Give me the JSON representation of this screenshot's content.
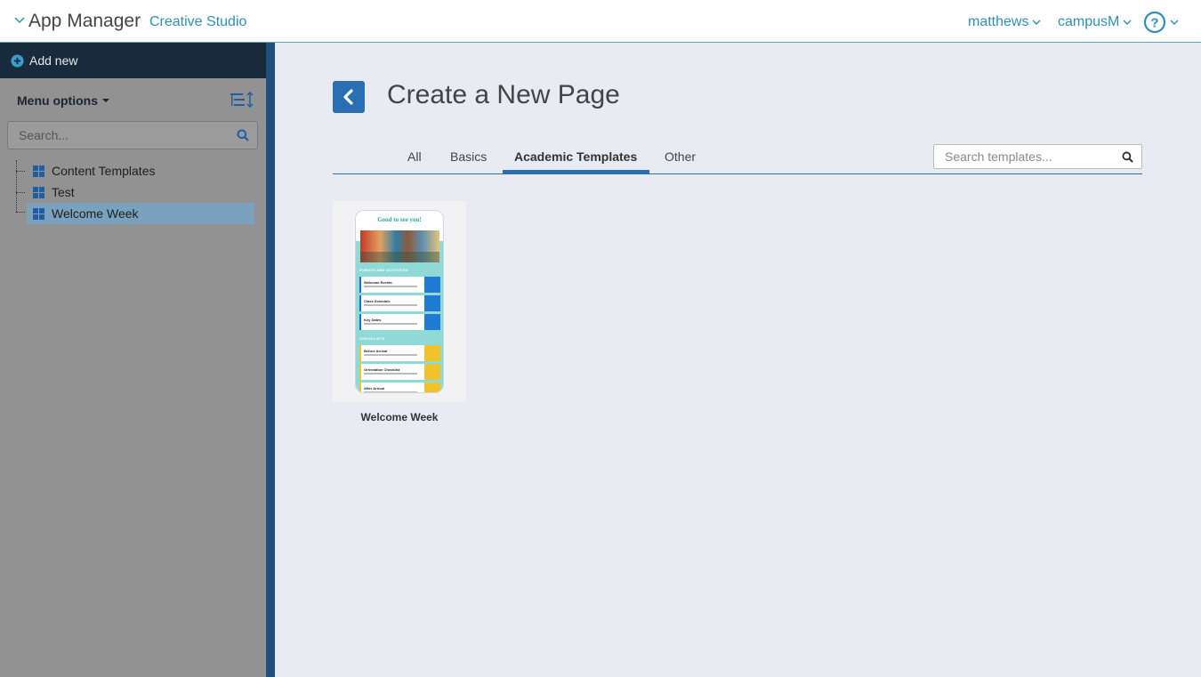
{
  "header": {
    "app_title": "App Manager",
    "app_subtitle": "Creative Studio",
    "user_menu": "matthews",
    "campus_menu": "campusM",
    "help_icon": "question-circle-icon"
  },
  "sidebar": {
    "add_new_label": "Add new",
    "menu_options_label": "Menu options",
    "search_placeholder": "Search...",
    "tree_items": [
      {
        "label": "Content Templates",
        "selected": false
      },
      {
        "label": "Test",
        "selected": false
      },
      {
        "label": "Welcome Week",
        "selected": true
      }
    ]
  },
  "main": {
    "title": "Create a New Page",
    "tabs": [
      {
        "label": "All",
        "active": false
      },
      {
        "label": "Basics",
        "active": false
      },
      {
        "label": "Academic Templates",
        "active": true
      },
      {
        "label": "Other",
        "active": false
      }
    ],
    "template_search_placeholder": "Search templates...",
    "templates": [
      {
        "label": "Welcome Week",
        "preview": {
          "heading": "Good to see you!",
          "section1": "EVENTS AND ACTIVITIES",
          "section1_items": [
            "Welcome Events",
            "Class Schedule",
            "Key Dates"
          ],
          "section2": "CHECKLISTS",
          "section2_items": [
            "Before Arrival",
            "Orientation Checklist",
            "After Arrival"
          ]
        }
      }
    ]
  },
  "colors": {
    "accent": "#2a6fb3",
    "link": "#2e8fb5",
    "sidebar_bg": "#929292",
    "addnew_bg": "#172b3d",
    "selected_item": "#7aa1bd"
  }
}
